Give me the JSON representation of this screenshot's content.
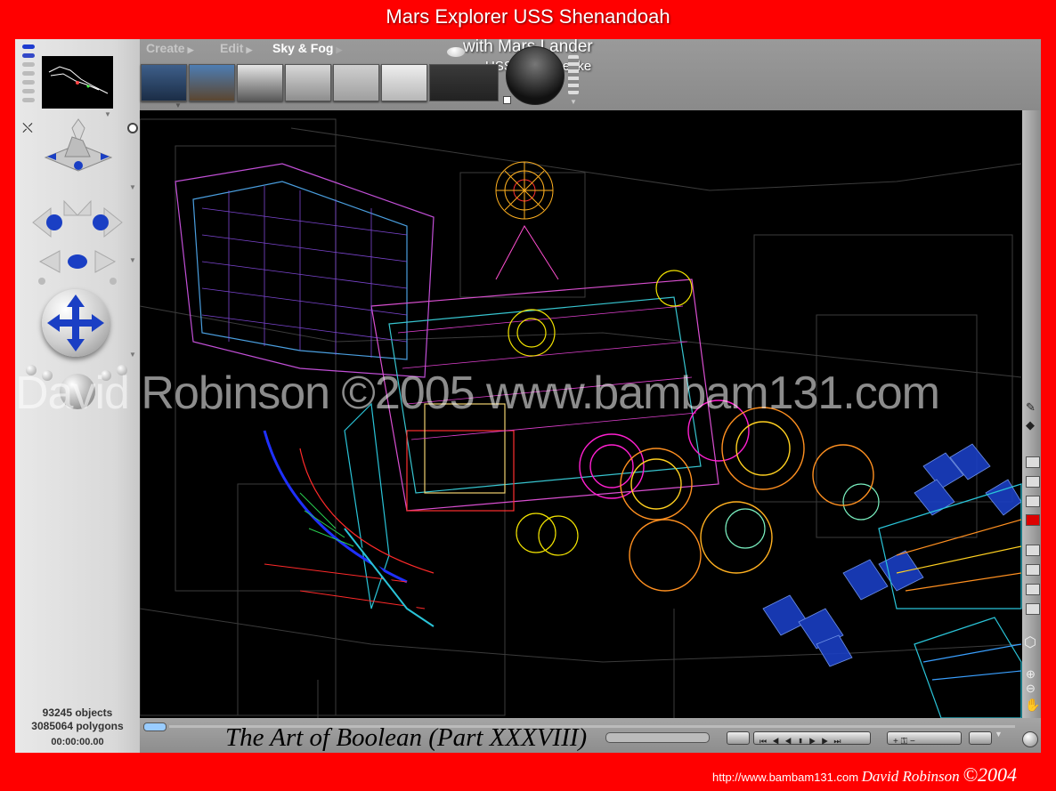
{
  "title": "Mars Explorer USS Shenandoah",
  "subtitle_line1": "with Mars Lander",
  "subtitle_line2": "USS Chesapeake",
  "menus": [
    {
      "label": "Create",
      "active": false
    },
    {
      "label": "Edit",
      "active": false
    },
    {
      "label": "Sky & Fog",
      "active": true
    }
  ],
  "thumbnails": [
    {
      "name": "sky-preset-1",
      "colors": [
        "#3e5f8a",
        "#1b2d46"
      ]
    },
    {
      "name": "sky-preset-2",
      "colors": [
        "#4d7db3",
        "#5b4630"
      ]
    },
    {
      "name": "sky-preset-3",
      "colors": [
        "#e6e6e6",
        "#5a5a5a"
      ]
    },
    {
      "name": "sky-preset-4",
      "colors": [
        "#d8d8d8",
        "#8e8e8e"
      ]
    },
    {
      "name": "sky-preset-5",
      "colors": [
        "#cfcfcf",
        "#9f9f9f"
      ]
    },
    {
      "name": "sky-preset-6",
      "colors": [
        "#eeeeee",
        "#b7b7b7"
      ]
    }
  ],
  "stats": {
    "objects": "93245 objects",
    "polygons": "3085064 polygons",
    "timecode": "00:00:00.00"
  },
  "watermark": "David Robinson ©2005 www.bambam131.com",
  "caption": "The Art of Boolean (Part XXXVIII)",
  "footer": {
    "url": "http://www.bambam131.com",
    "signature": "David Robinson",
    "copyright": "©2004"
  },
  "colors": {
    "border": "#ff0000",
    "panel": "#e4e4e4",
    "viewport": "#000000",
    "accent_blue": "#1a3fc4"
  }
}
